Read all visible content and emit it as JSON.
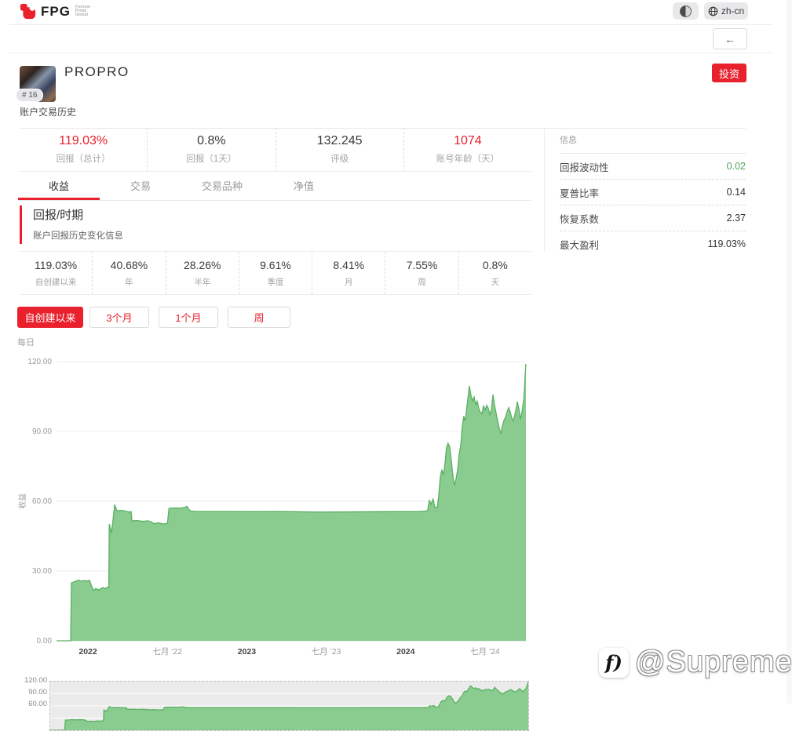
{
  "topbar": {
    "brand": "FPG",
    "brand_tagline": [
      "Fortune",
      "Prime",
      "Global"
    ],
    "language": "zh-cn"
  },
  "icons": {
    "back_arrow": "←",
    "theme_toggle": "half-moon-icon",
    "language_globe": "globe-icon",
    "watermark_glyph": "f)"
  },
  "profile": {
    "name": "PROPRO",
    "rank_badge": "# 16",
    "subtitle": "账户交易历史",
    "invest_button": "投资"
  },
  "summary_stats": [
    {
      "value": "119.03%",
      "label": "回报（总计）"
    },
    {
      "value": "0.8%",
      "label": "回报（1天）"
    },
    {
      "value": "132.245",
      "label": "评级"
    },
    {
      "value": "1074",
      "label": "账号年龄（天）"
    }
  ],
  "tabs": [
    {
      "label": "收益",
      "active": true
    },
    {
      "label": "交易",
      "active": false
    },
    {
      "label": "交易品种",
      "active": false
    },
    {
      "label": "净值",
      "active": false
    }
  ],
  "info_panel": {
    "title": "信息",
    "rows": [
      {
        "label": "回报波动性",
        "value": "0.02",
        "highlight": "green"
      },
      {
        "label": "夏普比率",
        "value": "0.14",
        "highlight": "none"
      },
      {
        "label": "恢复系数",
        "value": "2.37",
        "highlight": "none"
      },
      {
        "label": "最大盈利",
        "value": "119.03%",
        "highlight": "none"
      }
    ]
  },
  "returns_section": {
    "title": "回报/时期",
    "subtitle": "账户回报历史变化信息",
    "period_stats": [
      {
        "value": "119.03%",
        "label": "自创建以来"
      },
      {
        "value": "40.68%",
        "label": "年"
      },
      {
        "value": "28.26%",
        "label": "半年"
      },
      {
        "value": "9.61%",
        "label": "季度"
      },
      {
        "value": "8.41%",
        "label": "月"
      },
      {
        "value": "7.55%",
        "label": "周"
      },
      {
        "value": "0.8%",
        "label": "天"
      }
    ],
    "range_buttons": [
      {
        "label": "自创建以来",
        "active": true
      },
      {
        "label": "3个月",
        "active": false
      },
      {
        "label": "1个月",
        "active": false
      },
      {
        "label": "周",
        "active": false
      }
    ],
    "frequency_label": "每日"
  },
  "watermark": {
    "handle": "@Supremeee"
  },
  "colors": {
    "accent_red": "#e8212d",
    "chart_fill": "#8acb90",
    "chart_stroke": "#5ab162",
    "positive_green": "#55a45e",
    "grid": "#ededed"
  },
  "chart_data": {
    "type": "area",
    "title": "",
    "ylabel": "收益",
    "xlabel": "",
    "xlim": [
      2021.802,
      2024.757
    ],
    "ylim": [
      0,
      120
    ],
    "grid": "horizontal",
    "legend": "none",
    "yticks": [
      {
        "v": 0,
        "label": "0.00"
      },
      {
        "v": 30,
        "label": "30.00"
      },
      {
        "v": 60,
        "label": "60.00"
      },
      {
        "v": 90,
        "label": "90.00"
      },
      {
        "v": 120,
        "label": "120.00"
      }
    ],
    "xticks": [
      {
        "v": 2022.0,
        "label": "2022",
        "strong": true
      },
      {
        "v": 2022.5,
        "label": "七月 '22",
        "strong": false
      },
      {
        "v": 2023.0,
        "label": "2023",
        "strong": true
      },
      {
        "v": 2023.5,
        "label": "七月 '23",
        "strong": false
      },
      {
        "v": 2024.0,
        "label": "2024",
        "strong": true
      },
      {
        "v": 2024.5,
        "label": "七月 '24",
        "strong": false
      }
    ],
    "series": [
      {
        "name": "收益",
        "points": [
          [
            2021.802,
            0
          ],
          [
            2021.891,
            0
          ],
          [
            2021.896,
            24.9
          ],
          [
            2021.916,
            25.4
          ],
          [
            2021.941,
            26.1
          ],
          [
            2021.955,
            25.6
          ],
          [
            2021.975,
            25.9
          ],
          [
            2021.995,
            25.7
          ],
          [
            2022.01,
            26.0
          ],
          [
            2022.02,
            24.0
          ],
          [
            2022.035,
            21.7
          ],
          [
            2022.05,
            22.5
          ],
          [
            2022.064,
            21.9
          ],
          [
            2022.079,
            22.3
          ],
          [
            2022.094,
            22.9
          ],
          [
            2022.109,
            22.4
          ],
          [
            2022.124,
            23.1
          ],
          [
            2022.131,
            23.0
          ],
          [
            2022.134,
            50.2
          ],
          [
            2022.148,
            46.3
          ],
          [
            2022.158,
            52.0
          ],
          [
            2022.168,
            58.5
          ],
          [
            2022.183,
            55.9
          ],
          [
            2022.213,
            56.1
          ],
          [
            2022.238,
            55.7
          ],
          [
            2022.262,
            55.3
          ],
          [
            2022.272,
            55.5
          ],
          [
            2022.277,
            51.6
          ],
          [
            2022.312,
            51.7
          ],
          [
            2022.347,
            51.3
          ],
          [
            2022.376,
            51.6
          ],
          [
            2022.401,
            51.0
          ],
          [
            2022.416,
            50.3
          ],
          [
            2022.446,
            50.7
          ],
          [
            2022.475,
            50.2
          ],
          [
            2022.5,
            50.5
          ],
          [
            2022.51,
            56.9
          ],
          [
            2022.545,
            57.1
          ],
          [
            2022.579,
            57.0
          ],
          [
            2022.609,
            57.3
          ],
          [
            2022.624,
            57.8
          ],
          [
            2022.634,
            56.5
          ],
          [
            2022.649,
            55.8
          ],
          [
            2022.683,
            55.6
          ],
          [
            2022.832,
            55.6
          ],
          [
            2023.03,
            55.5
          ],
          [
            2023.228,
            55.6
          ],
          [
            2023.45,
            55.3
          ],
          [
            2023.673,
            55.4
          ],
          [
            2023.896,
            55.5
          ],
          [
            2024.069,
            55.5
          ],
          [
            2024.124,
            55.7
          ],
          [
            2024.139,
            56.1
          ],
          [
            2024.149,
            60.5
          ],
          [
            2024.158,
            58.7
          ],
          [
            2024.173,
            60.9
          ],
          [
            2024.183,
            57.4
          ],
          [
            2024.198,
            57.2
          ],
          [
            2024.208,
            62.3
          ],
          [
            2024.218,
            70.2
          ],
          [
            2024.228,
            73.6
          ],
          [
            2024.238,
            71.2
          ],
          [
            2024.248,
            76.5
          ],
          [
            2024.257,
            83.0
          ],
          [
            2024.267,
            84.9
          ],
          [
            2024.277,
            83.5
          ],
          [
            2024.287,
            78.0
          ],
          [
            2024.297,
            71.0
          ],
          [
            2024.307,
            66.8
          ],
          [
            2024.317,
            69.5
          ],
          [
            2024.327,
            73.5
          ],
          [
            2024.337,
            80.3
          ],
          [
            2024.347,
            84.0
          ],
          [
            2024.356,
            92.0
          ],
          [
            2024.366,
            96.5
          ],
          [
            2024.376,
            94.5
          ],
          [
            2024.386,
            101.0
          ],
          [
            2024.396,
            106.5
          ],
          [
            2024.401,
            109.5
          ],
          [
            2024.411,
            105.5
          ],
          [
            2024.421,
            103.0
          ],
          [
            2024.431,
            104.8
          ],
          [
            2024.441,
            101.5
          ],
          [
            2024.45,
            103.0
          ],
          [
            2024.46,
            100.0
          ],
          [
            2024.47,
            98.2
          ],
          [
            2024.48,
            97.6
          ],
          [
            2024.49,
            100.9
          ],
          [
            2024.5,
            99.2
          ],
          [
            2024.51,
            101.2
          ],
          [
            2024.52,
            100.0
          ],
          [
            2024.53,
            97.2
          ],
          [
            2024.54,
            99.5
          ],
          [
            2024.55,
            105.8
          ],
          [
            2024.559,
            101.5
          ],
          [
            2024.569,
            97.8
          ],
          [
            2024.579,
            94.5
          ],
          [
            2024.589,
            91.5
          ],
          [
            2024.599,
            89.0
          ],
          [
            2024.609,
            92.3
          ],
          [
            2024.619,
            94.8
          ],
          [
            2024.629,
            96.2
          ],
          [
            2024.639,
            98.5
          ],
          [
            2024.649,
            100.2
          ],
          [
            2024.658,
            98.3
          ],
          [
            2024.668,
            95.8
          ],
          [
            2024.678,
            94.5
          ],
          [
            2024.688,
            97.3
          ],
          [
            2024.698,
            100.5
          ],
          [
            2024.703,
            102.8
          ],
          [
            2024.713,
            99.5
          ],
          [
            2024.723,
            95.2
          ],
          [
            2024.733,
            98.5
          ],
          [
            2024.743,
            103.5
          ],
          [
            2024.748,
            108.0
          ],
          [
            2024.752,
            114.0
          ],
          [
            2024.757,
            119.03
          ]
        ]
      }
    ],
    "navigator": {
      "yticks": [
        {
          "v": 120,
          "label": "120.00"
        },
        {
          "v": 90,
          "label": "90.00"
        },
        {
          "v": 60,
          "label": "60.00"
        }
      ]
    }
  }
}
